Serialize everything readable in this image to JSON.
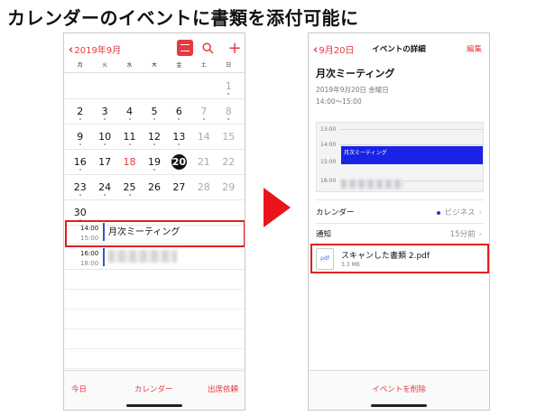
{
  "headline": "カレンダーのイベントに書類を添付可能に",
  "left_phone": {
    "month_label": "2019年9月",
    "weekdays": [
      "月",
      "火",
      "水",
      "木",
      "金",
      "土",
      "日"
    ],
    "weeks": [
      [
        {
          "n": "",
          "s": "empty"
        },
        {
          "n": "",
          "s": "empty"
        },
        {
          "n": "",
          "s": "empty"
        },
        {
          "n": "",
          "s": "empty"
        },
        {
          "n": "",
          "s": "empty"
        },
        {
          "n": "",
          "s": "empty"
        },
        {
          "n": "1",
          "s": "gray",
          "dot": true
        }
      ],
      [
        {
          "n": "2",
          "dot": true
        },
        {
          "n": "3",
          "dot": true
        },
        {
          "n": "4",
          "dot": true
        },
        {
          "n": "5",
          "dot": true
        },
        {
          "n": "6",
          "dot": true
        },
        {
          "n": "7",
          "s": "gray",
          "dot": true
        },
        {
          "n": "8",
          "s": "gray",
          "dot": true
        }
      ],
      [
        {
          "n": "9",
          "dot": true
        },
        {
          "n": "10",
          "dot": true
        },
        {
          "n": "11",
          "dot": true
        },
        {
          "n": "12",
          "dot": true
        },
        {
          "n": "13",
          "dot": true
        },
        {
          "n": "14",
          "s": "gray"
        },
        {
          "n": "15",
          "s": "gray"
        }
      ],
      [
        {
          "n": "16",
          "dot": true
        },
        {
          "n": "17"
        },
        {
          "n": "18",
          "s": "holiday"
        },
        {
          "n": "19",
          "dot": true
        },
        {
          "n": "20",
          "s": "today"
        },
        {
          "n": "21",
          "s": "gray"
        },
        {
          "n": "22",
          "s": "gray"
        }
      ],
      [
        {
          "n": "23",
          "dot": true
        },
        {
          "n": "24",
          "dot": true
        },
        {
          "n": "25",
          "dot": true
        },
        {
          "n": "26"
        },
        {
          "n": "27"
        },
        {
          "n": "28",
          "s": "gray"
        },
        {
          "n": "29",
          "s": "gray"
        }
      ],
      [
        {
          "n": "30",
          "dot": true
        },
        {
          "n": "",
          "s": "empty"
        },
        {
          "n": "",
          "s": "empty"
        },
        {
          "n": "",
          "s": "empty"
        },
        {
          "n": "",
          "s": "empty"
        },
        {
          "n": "",
          "s": "empty"
        },
        {
          "n": "",
          "s": "empty"
        }
      ]
    ],
    "events": [
      {
        "start": "14:00",
        "end": "15:00",
        "title": "月次ミーティング",
        "blurred": false
      },
      {
        "start": "16:00",
        "end": "18:00",
        "title": "",
        "blurred": true
      }
    ],
    "tabs": {
      "today": "今日",
      "calendars": "カレンダー",
      "inbox": "出席依頼"
    }
  },
  "right_phone": {
    "back_label": "9月20日",
    "nav_title": "イベントの詳細",
    "edit_label": "編集",
    "event_title": "月次ミーティング",
    "event_date": "2019年9月20日 金曜日",
    "event_time": "14:00〜15:00",
    "mini_day": {
      "hours": [
        "13:00",
        "14:00",
        "15:00",
        "16:00"
      ],
      "event_label": "月次ミーティング"
    },
    "calendar_row": {
      "label": "カレンダー",
      "value": "ビジネス"
    },
    "alert_row": {
      "label": "通知",
      "value": "15分前"
    },
    "attachment": {
      "icon_text": "pdf",
      "name": "スキャンした書類 2.pdf",
      "size": "3.3 MB"
    },
    "delete_label": "イベントを削除"
  },
  "colors": {
    "accent": "#e8383d",
    "highlight": "#e02020",
    "event_blue": "#1a22e6",
    "arrow": "#e8151b"
  }
}
